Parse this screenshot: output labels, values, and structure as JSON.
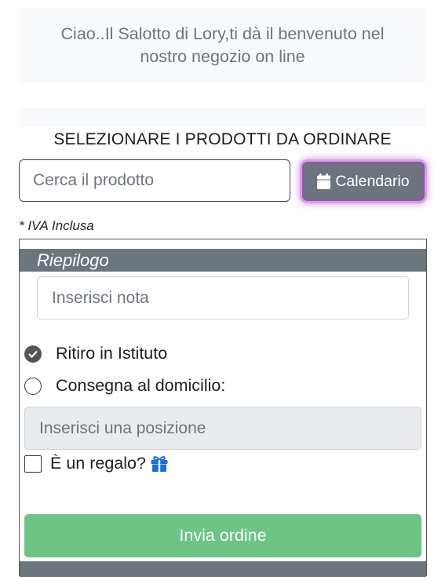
{
  "welcome": {
    "line1": "Ciao..Il Salotto di Lory,ti dà il benvenuto nel",
    "line2": "nostro negozio on line"
  },
  "section_title": "SELEZIONARE I PRODOTTI DA ORDINARE",
  "search": {
    "placeholder": "Cerca il prodotto",
    "value": ""
  },
  "calendar_button": {
    "label": "Calendario",
    "icon": "calendar-icon"
  },
  "iva_note": "* IVA Inclusa",
  "summary": {
    "header": "Riepilogo",
    "note": {
      "placeholder": "Inserisci nota",
      "value": ""
    },
    "delivery_options": [
      {
        "label": "Ritiro in Istituto",
        "selected": true
      },
      {
        "label": "Consegna al domicilio:",
        "selected": false
      }
    ],
    "position": {
      "placeholder": "Inserisci una posizione",
      "value": ""
    },
    "gift": {
      "label": "È un regalo?",
      "checked": false,
      "icon": "gift-icon"
    },
    "submit_label": "Invia ordine"
  },
  "colors": {
    "secondary": "#6c757d",
    "success": "#6cc485",
    "focus_glow": "#c88be0",
    "gift_icon": "#1a6fd6"
  }
}
